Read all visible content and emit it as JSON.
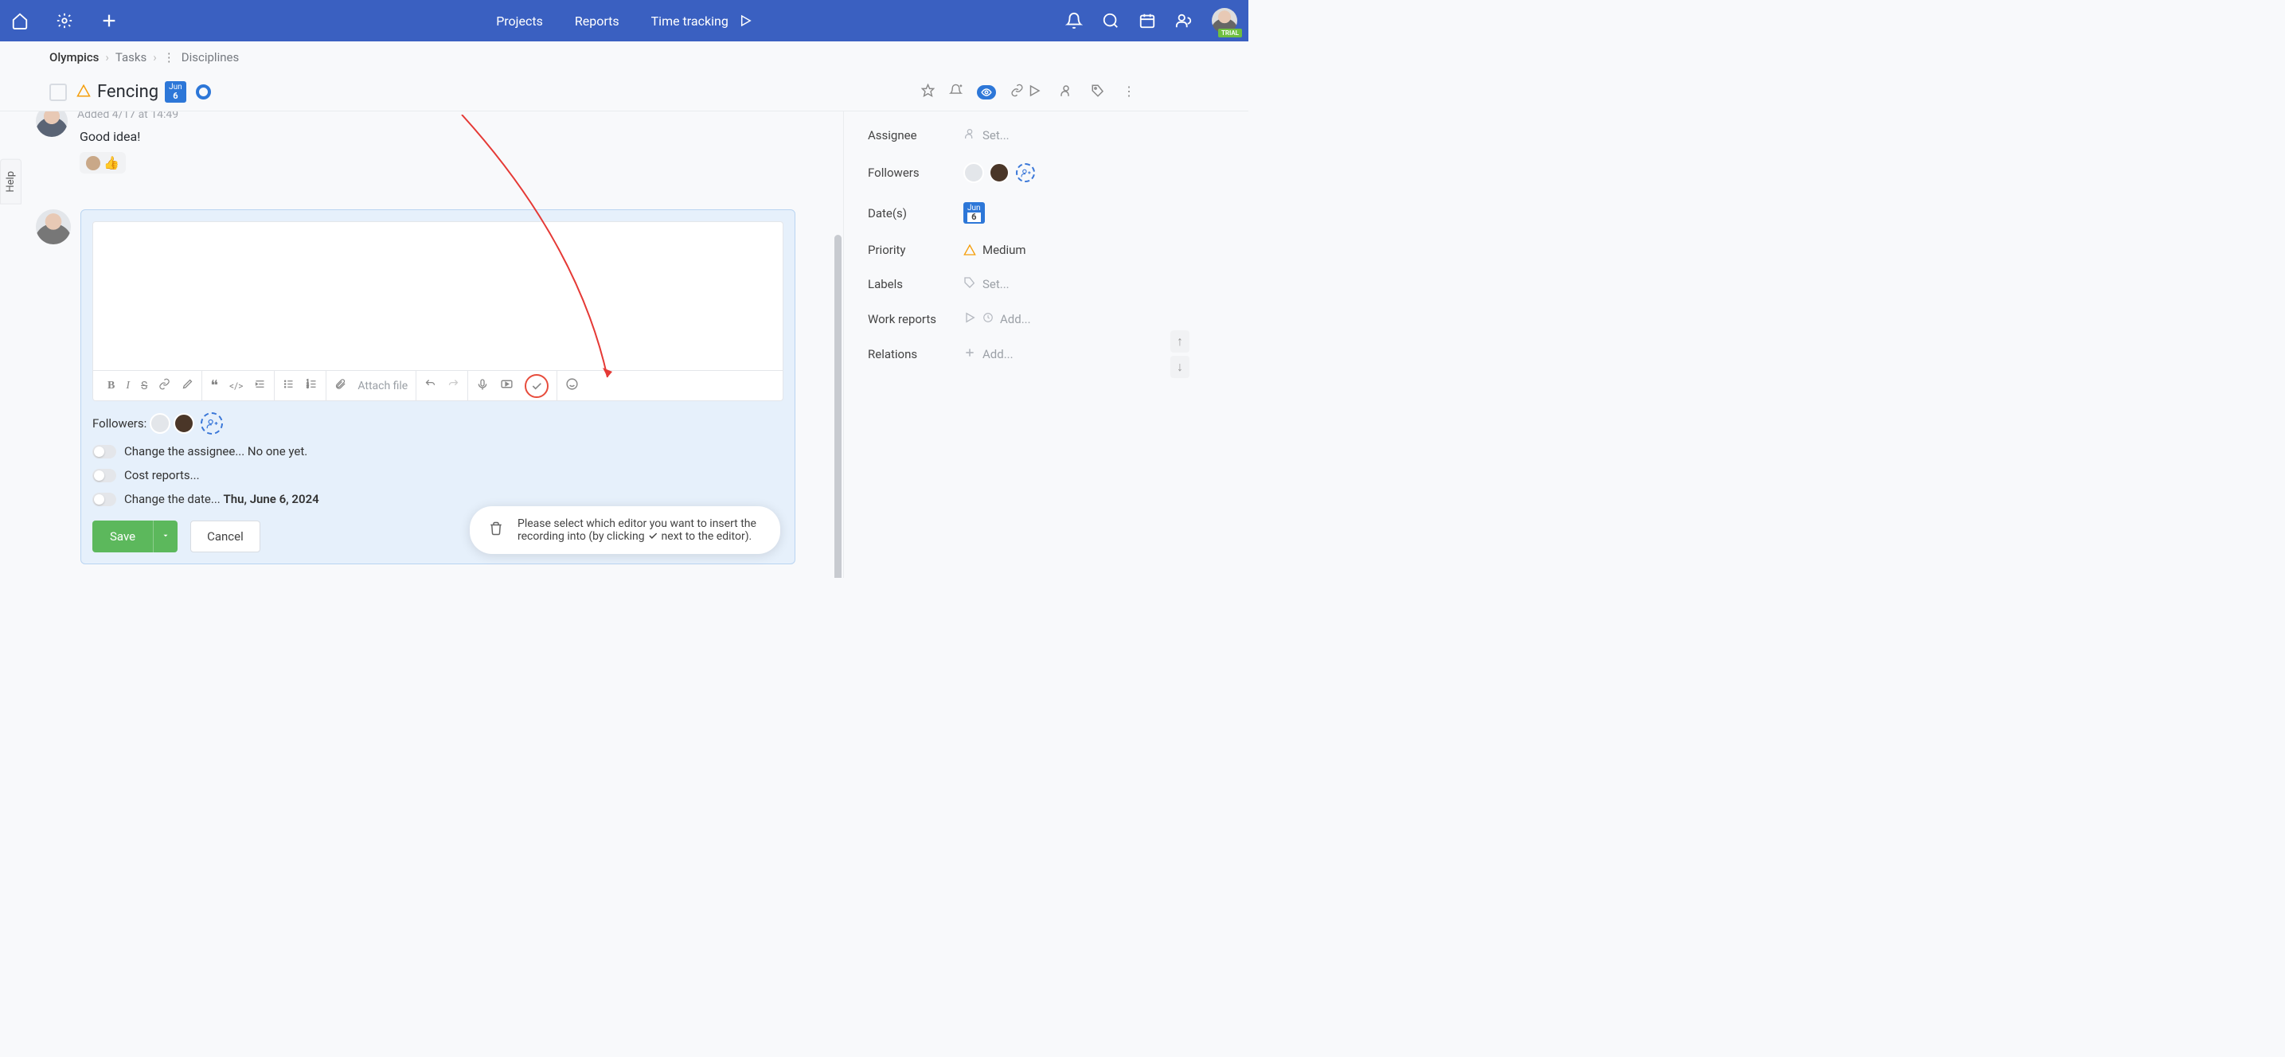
{
  "topbar": {
    "nav": {
      "projects": "Projects",
      "reports": "Reports",
      "time_tracking": "Time tracking"
    },
    "trial_label": "TRIAL"
  },
  "breadcrumb": {
    "root": "Olympics",
    "second": "Tasks",
    "leaf": "Disciplines"
  },
  "task": {
    "title": "Fencing",
    "date_month": "Jun",
    "date_day": "6"
  },
  "comment": {
    "meta": "Added 4/17 at 14:49",
    "body": "Good idea!",
    "reaction": "👍"
  },
  "editor": {
    "attach_label": "Attach file",
    "followers_label": "Followers:",
    "toggles": {
      "assignee_prefix": "Change the assignee... ",
      "assignee_value": "No one yet.",
      "cost": "Cost reports...",
      "date_prefix": "Change the date... ",
      "date_value": "Thu, June 6, 2024"
    },
    "save": "Save",
    "cancel": "Cancel"
  },
  "tooltip": {
    "text_a": "Please select which editor you want to insert the recording into (by clicking ",
    "text_b": " next to the editor)."
  },
  "sidebar": {
    "assignee": {
      "label": "Assignee",
      "placeholder": "Set..."
    },
    "followers": {
      "label": "Followers"
    },
    "dates": {
      "label": "Date(s)",
      "month": "Jun",
      "day": "6"
    },
    "priority": {
      "label": "Priority",
      "value": "Medium"
    },
    "labels": {
      "label": "Labels",
      "placeholder": "Set..."
    },
    "work_reports": {
      "label": "Work reports",
      "placeholder": "Add..."
    },
    "relations": {
      "label": "Relations",
      "placeholder": "Add..."
    }
  },
  "help": "Help"
}
